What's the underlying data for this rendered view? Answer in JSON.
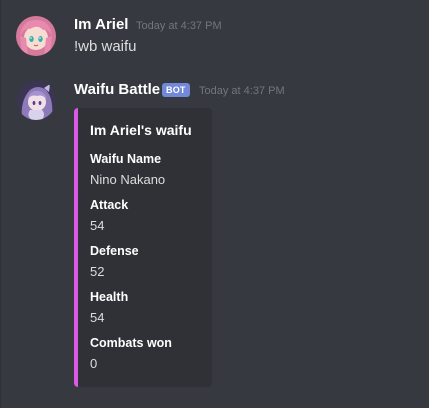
{
  "messages": [
    {
      "author": "Im Ariel",
      "timestamp": "Today at 4:37 PM",
      "content": "!wb waifu"
    },
    {
      "author": "Waifu Battle",
      "bot_tag": "BOT",
      "timestamp": "Today at 4:37 PM",
      "embed": {
        "title": "Im Ariel's waifu",
        "accent_color": "#da5ae6",
        "fields": [
          {
            "name": "Waifu Name",
            "value": "Nino Nakano"
          },
          {
            "name": "Attack",
            "value": "54"
          },
          {
            "name": "Defense",
            "value": "52"
          },
          {
            "name": "Health",
            "value": "54"
          },
          {
            "name": "Combats won",
            "value": "0"
          }
        ]
      }
    }
  ],
  "icons": {
    "user_avatar": "anime-avatar-pink-hair",
    "bot_avatar": "anime-avatar-purple-hair"
  },
  "colors": {
    "background": "#36393f",
    "embed_background": "#2f3136",
    "bot_tag": "#7289da",
    "timestamp": "#72767d"
  }
}
